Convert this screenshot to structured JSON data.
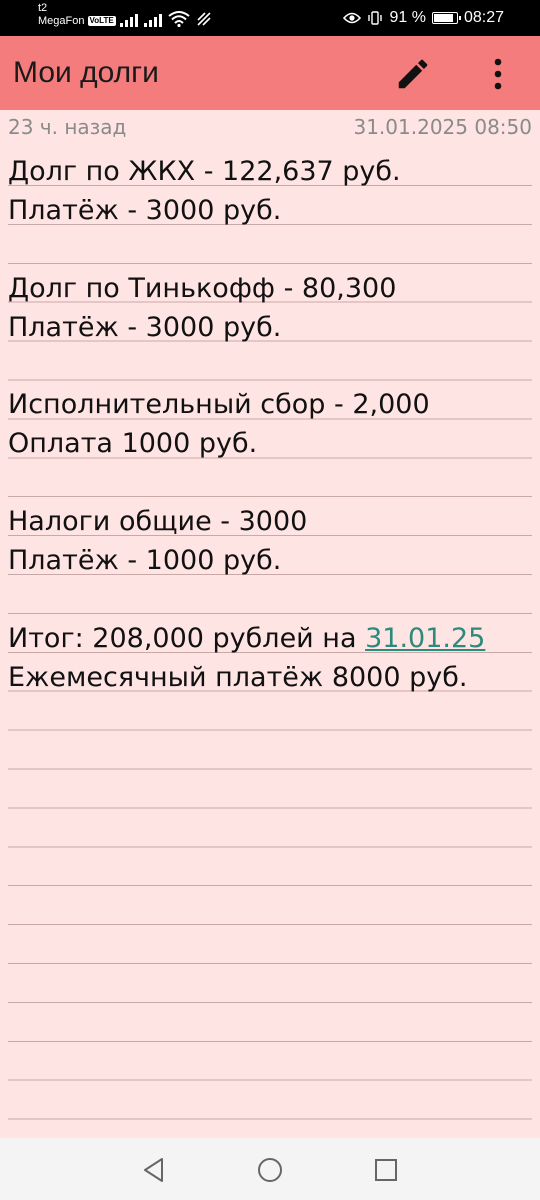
{
  "status_bar": {
    "carrier_top": "t2",
    "carrier_bottom": "MegaFon",
    "volte": "VoLTE",
    "battery_text": "91 %",
    "battery_level": 0.91,
    "time": "08:27"
  },
  "app_bar": {
    "title": "Мои долги",
    "edit_icon": "pencil-icon",
    "more_icon": "more-vert-icon"
  },
  "note": {
    "modified_relative": "23 ч. назад",
    "modified_datetime": "31.01.2025 08:50",
    "lines": [
      "Долг по ЖКХ - 122,637 руб.",
      "Платёж - 3000 руб.",
      "",
      "Долг по Тинькофф - 80,300",
      "Платёж - 3000 руб.",
      "",
      "Исполнительный сбор - 2,000",
      "Оплата 1000 руб.",
      "",
      "Налоги общие - 3000",
      "Платёж - 1000 руб.",
      "",
      "Итог: 208,000 рублей на ",
      "Ежемесячный платёж 8000 руб."
    ],
    "total_date_link": "31.01.25"
  },
  "nav_bar": {
    "back_icon": "back-triangle-icon",
    "home_icon": "home-circle-icon",
    "recents_icon": "recents-square-icon"
  },
  "colors": {
    "app_bar": "#f47c7c",
    "background": "#ffe4e4",
    "link": "#2b8a7c",
    "meta_text": "#8a8a8a"
  }
}
